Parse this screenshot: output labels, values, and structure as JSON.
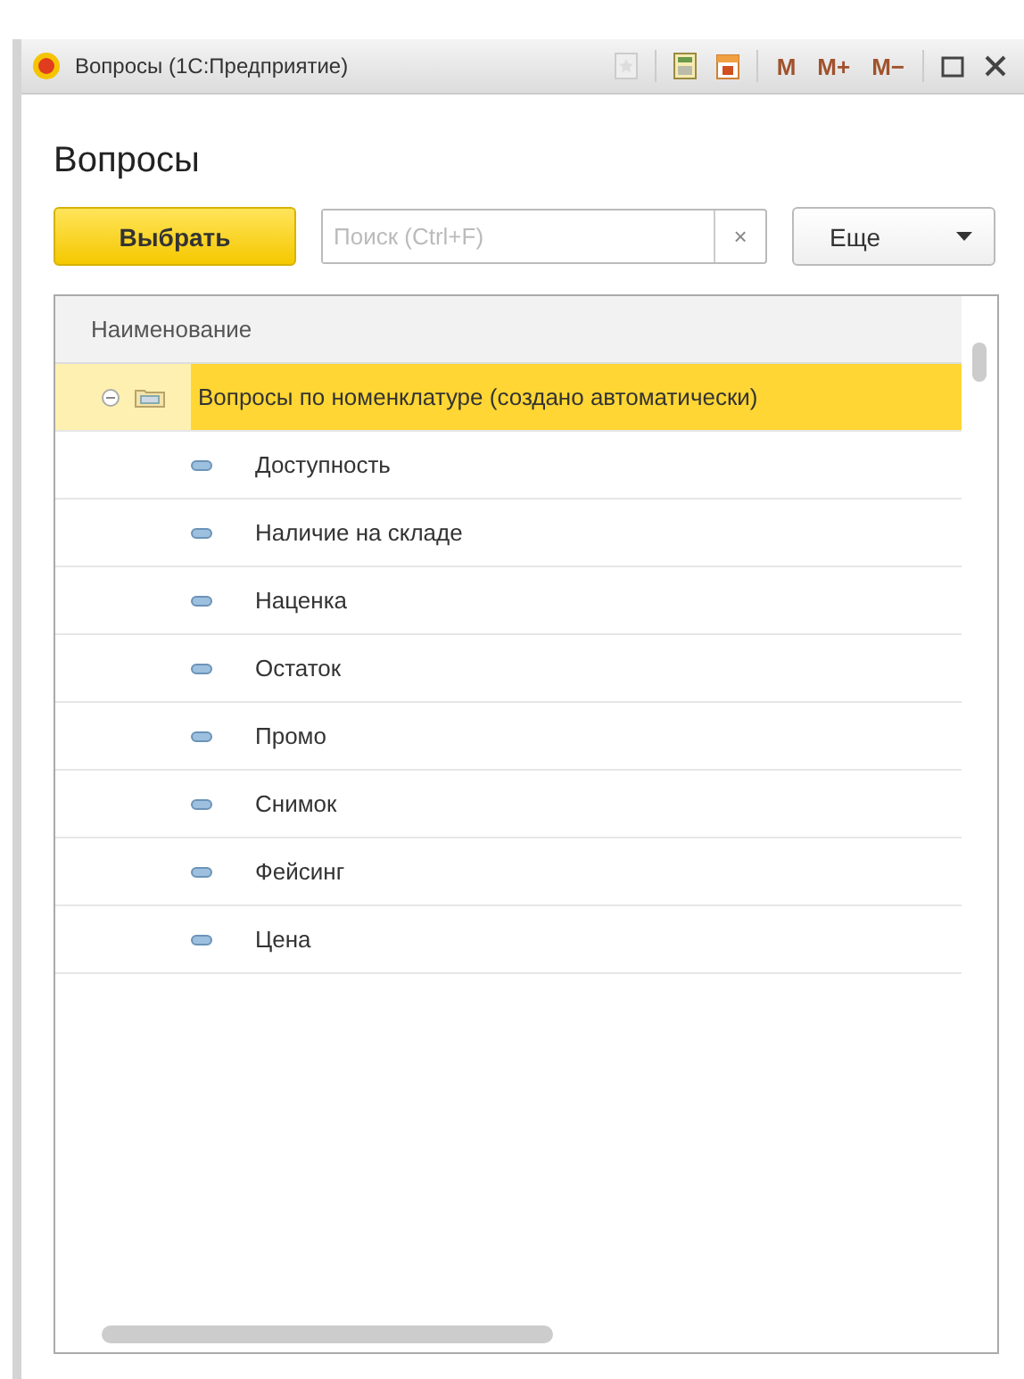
{
  "window": {
    "title": "Вопросы (1С:Предприятие)",
    "toolbar": [
      "M",
      "M+",
      "M−"
    ]
  },
  "form": {
    "title": "Вопросы"
  },
  "command_bar": {
    "choose_button": "Выбрать",
    "search": {
      "placeholder": "Поиск (Ctrl+F)",
      "clear": "×"
    },
    "more_button": "Еще"
  },
  "table": {
    "columns": [
      "Наименование"
    ],
    "rows": [
      {
        "kind": "group",
        "name": "Вопросы по номенклатуре (создано автоматически)",
        "expanded": true,
        "selected": true,
        "children": [
          {
            "kind": "item",
            "name": "Доступность",
            "selected": false
          },
          {
            "kind": "item",
            "name": "Наличие на складе",
            "selected": false
          },
          {
            "kind": "item",
            "name": "Наценка",
            "selected": false
          },
          {
            "kind": "item",
            "name": "Остаток",
            "selected": false
          },
          {
            "kind": "item",
            "name": "Промо",
            "selected": false
          },
          {
            "kind": "item",
            "name": "Снимок",
            "selected": false
          },
          {
            "kind": "item",
            "name": "Фейсинг",
            "selected": false
          },
          {
            "kind": "item",
            "name": "Цена",
            "selected": false
          }
        ]
      }
    ]
  }
}
